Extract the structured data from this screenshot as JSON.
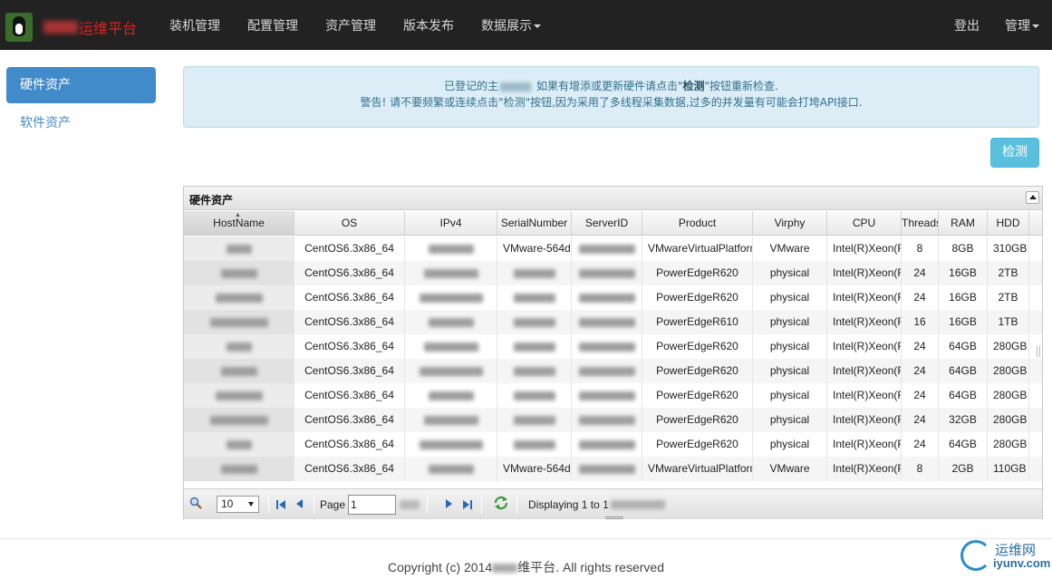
{
  "navbar": {
    "brand_title": "运维平台",
    "items": [
      "装机管理",
      "配置管理",
      "资产管理",
      "版本发布",
      "数据展示"
    ],
    "right_items": [
      "登出",
      "管理"
    ]
  },
  "sidebar": {
    "items": [
      {
        "label": "硬件资产",
        "active": true
      },
      {
        "label": "软件资产",
        "active": false
      }
    ]
  },
  "alert": {
    "line1_a": "已登记的主",
    "line1_b": "如果有增添或更新硬件请点击\"",
    "line1_bold": "检测",
    "line1_c": "\"按钮重新检查.",
    "line2": "警告! 请不要频繁或连续点击\"检测\"按钮,因为采用了多线程采集数据,过多的并发量有可能会打垮API接口."
  },
  "check_button": "检测",
  "grid": {
    "title": "硬件资产",
    "columns": [
      "HostName",
      "OS",
      "IPv4",
      "SerialNumber",
      "ServerID",
      "Product",
      "Virphy",
      "CPU",
      "Threads",
      "RAM",
      "HDD"
    ],
    "rows": [
      {
        "os": "CentOS6.3x86_64",
        "serial": "VMware-564d",
        "product": "VMwareVirtualPlatform",
        "virphy": "VMware",
        "cpu": "Intel(R)Xeon(R)",
        "threads": "8",
        "ram": "8GB",
        "hdd": "310GB"
      },
      {
        "os": "CentOS6.3x86_64",
        "serial": "",
        "product": "PowerEdgeR620",
        "virphy": "physical",
        "cpu": "Intel(R)Xeon(R)",
        "threads": "24",
        "ram": "16GB",
        "hdd": "2TB"
      },
      {
        "os": "CentOS6.3x86_64",
        "serial": "",
        "product": "PowerEdgeR620",
        "virphy": "physical",
        "cpu": "Intel(R)Xeon(R)",
        "threads": "24",
        "ram": "16GB",
        "hdd": "2TB"
      },
      {
        "os": "CentOS6.3x86_64",
        "serial": "",
        "product": "PowerEdgeR610",
        "virphy": "physical",
        "cpu": "Intel(R)Xeon(R)",
        "threads": "16",
        "ram": "16GB",
        "hdd": "1TB"
      },
      {
        "os": "CentOS6.3x86_64",
        "serial": "",
        "product": "PowerEdgeR620",
        "virphy": "physical",
        "cpu": "Intel(R)Xeon(R)",
        "threads": "24",
        "ram": "64GB",
        "hdd": "280GB"
      },
      {
        "os": "CentOS6.3x86_64",
        "serial": "",
        "product": "PowerEdgeR620",
        "virphy": "physical",
        "cpu": "Intel(R)Xeon(R)",
        "threads": "24",
        "ram": "64GB",
        "hdd": "280GB"
      },
      {
        "os": "CentOS6.3x86_64",
        "serial": "",
        "product": "PowerEdgeR620",
        "virphy": "physical",
        "cpu": "Intel(R)Xeon(R)",
        "threads": "24",
        "ram": "64GB",
        "hdd": "280GB"
      },
      {
        "os": "CentOS6.3x86_64",
        "serial": "",
        "product": "PowerEdgeR620",
        "virphy": "physical",
        "cpu": "Intel(R)Xeon(R)",
        "threads": "24",
        "ram": "32GB",
        "hdd": "280GB"
      },
      {
        "os": "CentOS6.3x86_64",
        "serial": "",
        "product": "PowerEdgeR620",
        "virphy": "physical",
        "cpu": "Intel(R)Xeon(R)",
        "threads": "24",
        "ram": "64GB",
        "hdd": "280GB"
      },
      {
        "os": "CentOS6.3x86_64",
        "serial": "VMware-564d",
        "product": "VMwareVirtualPlatform",
        "virphy": "VMware",
        "cpu": "Intel(R)Xeon(R)",
        "threads": "8",
        "ram": "2GB",
        "hdd": "110GB"
      }
    ]
  },
  "pager": {
    "page_size": "10",
    "page_label": "Page",
    "page_value": "1",
    "displaying": "Displaying 1 to 1"
  },
  "footer": {
    "copyright_a": "Copyright (c) 2014",
    "copyright_b": "维平台. All rights reserved"
  },
  "watermark": {
    "line1": "运维网",
    "line2": "iyunv.com"
  }
}
